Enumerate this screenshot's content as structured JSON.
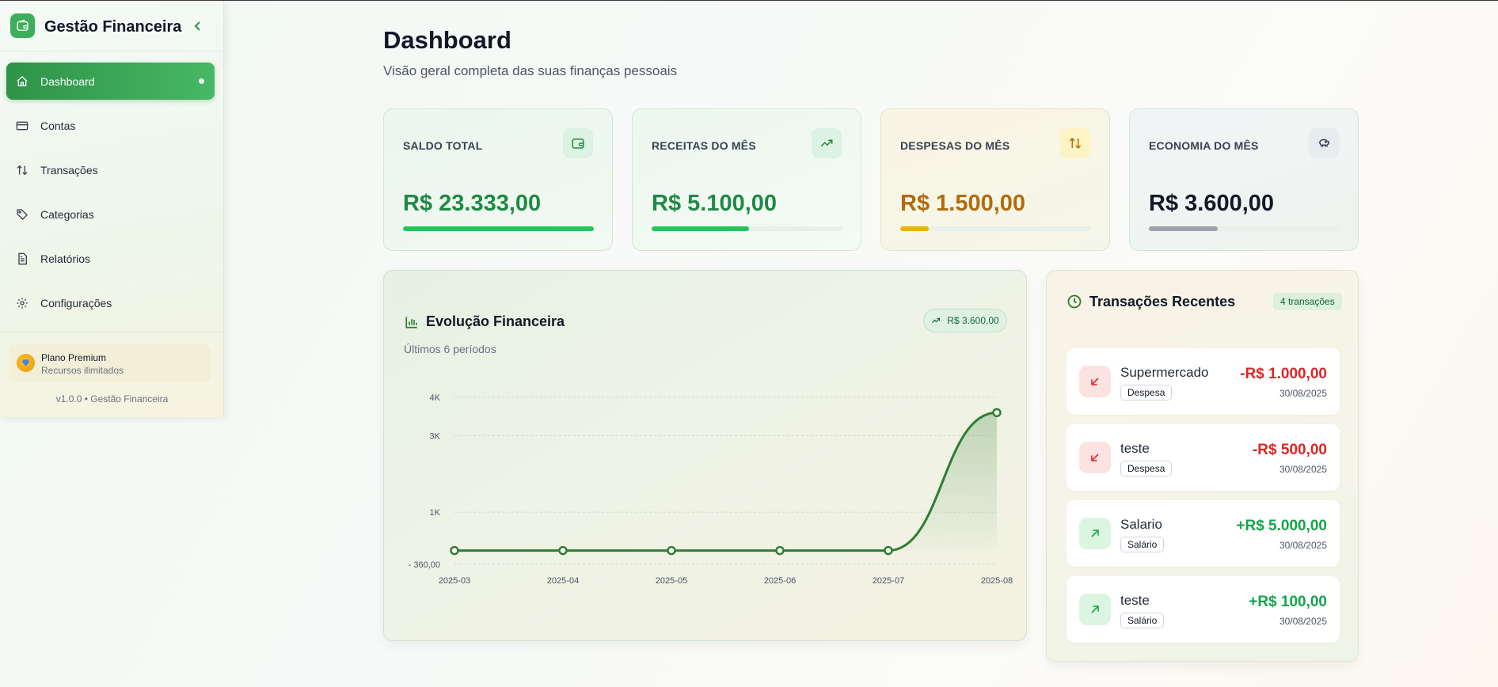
{
  "sidebar": {
    "title": "Gestão Financeira",
    "items": [
      {
        "label": "Dashboard",
        "icon": "home-icon",
        "active": true
      },
      {
        "label": "Contas",
        "icon": "credit-card-icon"
      },
      {
        "label": "Transações",
        "icon": "arrows-up-down-icon"
      },
      {
        "label": "Categorias",
        "icon": "tag-icon"
      },
      {
        "label": "Relatórios",
        "icon": "file-icon"
      },
      {
        "label": "Configurações",
        "icon": "gear-icon"
      }
    ],
    "plan": {
      "name": "Plano Premium",
      "subtitle": "Recursos ilimitados"
    },
    "version": "v1.0.0 • Gestão Financeira"
  },
  "header": {
    "title": "Dashboard",
    "subtitle": "Visão geral completa das suas finanças pessoais"
  },
  "cards": [
    {
      "label": "SALDO TOTAL",
      "value": "R$ 23.333,00",
      "progress": 1.0,
      "color": "#1e8a43",
      "bar_color": "#22c55e",
      "icon": "wallet-icon"
    },
    {
      "label": "RECEITAS DO MÊS",
      "value": "R$ 5.100,00",
      "progress": 0.51,
      "color": "#1e8a43",
      "bar_color": "#22c55e",
      "icon": "trending-up-icon"
    },
    {
      "label": "DESPESAS DO MÊS",
      "value": "R$ 1.500,00",
      "progress": 0.15,
      "color": "#b16b0c",
      "bar_color": "#eab308",
      "icon": "arrows-up-down-icon"
    },
    {
      "label": "ECONOMIA DO MÊS",
      "value": "R$ 3.600,00",
      "progress": 0.36,
      "color": "#111827",
      "bar_color": "#9ca3af",
      "icon": "piggy-bank-icon"
    }
  ],
  "chart_panel": {
    "title": "Evolução Financeira",
    "subtitle": "Últimos 6 períodos",
    "badge": "R$ 3.600,00"
  },
  "chart_data": {
    "type": "area",
    "x": [
      "2025-03",
      "2025-04",
      "2025-05",
      "2025-06",
      "2025-07",
      "2025-08"
    ],
    "values": [
      0,
      0,
      0,
      0,
      0,
      3600
    ],
    "y_ticks": [
      {
        "value": 4000,
        "label": "4K"
      },
      {
        "value": 3000,
        "label": "3K"
      },
      {
        "value": 1000,
        "label": "1K"
      },
      {
        "value": -360,
        "label": "- 360,00"
      }
    ],
    "ylim": [
      -360,
      4000
    ],
    "grid": true,
    "line_color": "#2e7d32"
  },
  "transactions": {
    "title": "Transações Recentes",
    "count": "4 transações",
    "items": [
      {
        "name": "Supermercado",
        "tag": "Despesa",
        "amount": "-R$ 1.000,00",
        "date": "30/08/2025",
        "kind": "out"
      },
      {
        "name": "teste",
        "tag": "Despesa",
        "amount": "-R$ 500,00",
        "date": "30/08/2025",
        "kind": "out"
      },
      {
        "name": "Salario",
        "tag": "Salário",
        "amount": "+R$ 5.000,00",
        "date": "30/08/2025",
        "kind": "in"
      },
      {
        "name": "teste",
        "tag": "Salário",
        "amount": "+R$ 100,00",
        "date": "30/08/2025",
        "kind": "in"
      }
    ]
  }
}
